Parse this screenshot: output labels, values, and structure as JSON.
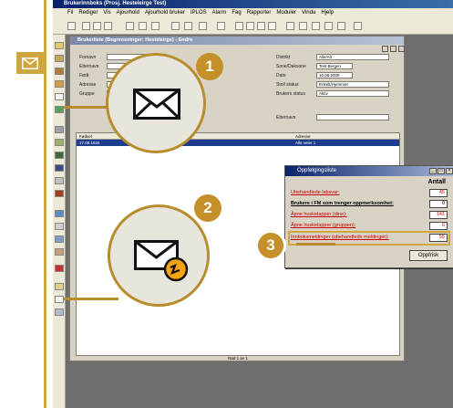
{
  "app": {
    "title": "Brukerinnboks (Prosj. Hesteleirge Test)"
  },
  "menu": [
    "Fil",
    "Rediger",
    "Vis",
    "Ajourhold",
    "Ajourhold bruker",
    "IPLOS",
    "Alarm",
    "Fag",
    "Rapporter",
    "Moduler",
    "Vindu",
    "Hjelp"
  ],
  "window": {
    "title": "Brukerliste (Begrensninger: Hesteleirge) - Endre",
    "fields": [
      {
        "label": "Fornavn",
        "value": ""
      },
      {
        "label": "Etternavn",
        "value": ""
      },
      {
        "label": "Født",
        "value": ""
      },
      {
        "label": "Adresse",
        "value": ""
      },
      {
        "label": "Gruppe",
        "value": ""
      }
    ],
    "right_fields": [
      {
        "label": "Distrikt",
        "value": "Alle/Alt"
      },
      {
        "label": "Sone/Daksone",
        "value": "Test Bergen"
      },
      {
        "label": "Dato",
        "value": "10.08.2009"
      },
      {
        "label": "Stoil status",
        "value": "Enkelt/Hjemmet"
      },
      {
        "label": "Brukers status",
        "value": "Aktiv"
      },
      {
        "label": "Etternavn",
        "value": ""
      }
    ],
    "grid_headers": [
      "Fødsel",
      "Adresse"
    ],
    "grid_row": [
      "17.08.1934",
      "Alle veier 1"
    ],
    "status": "Rad 1 av 1"
  },
  "popup": {
    "title": "Oppfølgingsliste",
    "column_header": "Antall",
    "rows": [
      {
        "label": "Ubehandlede labsvar:",
        "value": "45",
        "color": "#cc0000"
      },
      {
        "label": "Brukere i FM som trenger oppmerksomhet:",
        "value": "0",
        "color": "#000000"
      },
      {
        "label": "Åpne huskelapper (dine):",
        "value": "141",
        "color": "#cc0000"
      },
      {
        "label": "Åpne huskelapper (gruppen):",
        "value": "6",
        "color": "#cc0000"
      },
      {
        "label": "Innboksmeldinger (ubehandlede meldinger):",
        "value": "55",
        "color": "#cc0000"
      }
    ],
    "button_label": "Oppfrisk"
  },
  "callouts": [
    {
      "number": "1"
    },
    {
      "number": "2"
    },
    {
      "number": "3"
    }
  ],
  "colors": {
    "accent": "#d2a63e",
    "badge_orange": "#f3a313"
  },
  "icons": [
    "envelope-icon",
    "envelope-refresh-icon"
  ]
}
